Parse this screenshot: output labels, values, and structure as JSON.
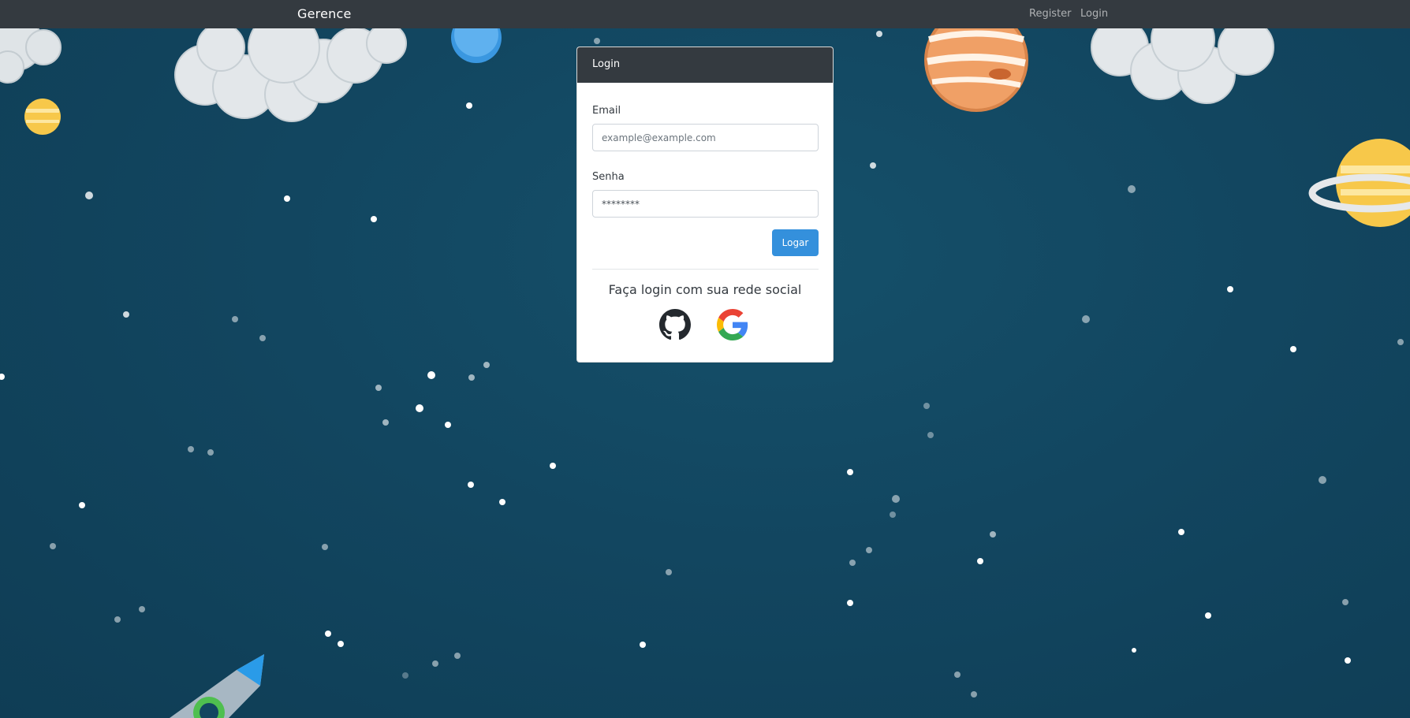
{
  "navbar": {
    "brand": "Gerence",
    "links": {
      "register": "Register",
      "login": "Login"
    }
  },
  "login_card": {
    "header": "Login",
    "email": {
      "label": "Email",
      "placeholder": "example@example.com",
      "value": ""
    },
    "password": {
      "label": "Senha",
      "placeholder": "",
      "value": "********"
    },
    "submit_label": "Logar",
    "social": {
      "title": "Faça login com sua rede social",
      "providers": [
        "github-icon",
        "google-icon"
      ]
    }
  },
  "colors": {
    "navbar": "#343a40",
    "background": "#124660",
    "primary_button": "#3490dc"
  }
}
